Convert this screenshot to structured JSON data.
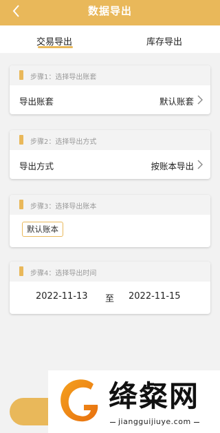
{
  "header": {
    "title": "数据导出",
    "back_icon": "chevron-left-icon",
    "color": "#e9b85a"
  },
  "tabs": [
    {
      "label": "交易导出",
      "active": true
    },
    {
      "label": "库存导出",
      "active": false
    }
  ],
  "steps": [
    {
      "label": "步骤1：选择导出账套",
      "row_label": "导出账套",
      "row_value": "默认账套"
    },
    {
      "label": "步骤2：选择导出方式",
      "row_label": "导出方式",
      "row_value": "按账本导出"
    },
    {
      "label": "步骤3：选择导出账本",
      "tag": "默认账本"
    },
    {
      "label": "步骤4：选择导出时间",
      "start_date": "2022-11-13",
      "separator": "至",
      "end_date": "2022-11-15"
    }
  ],
  "watermark": {
    "brand": "绛粲网",
    "url": "jiangguijiuye.com"
  }
}
